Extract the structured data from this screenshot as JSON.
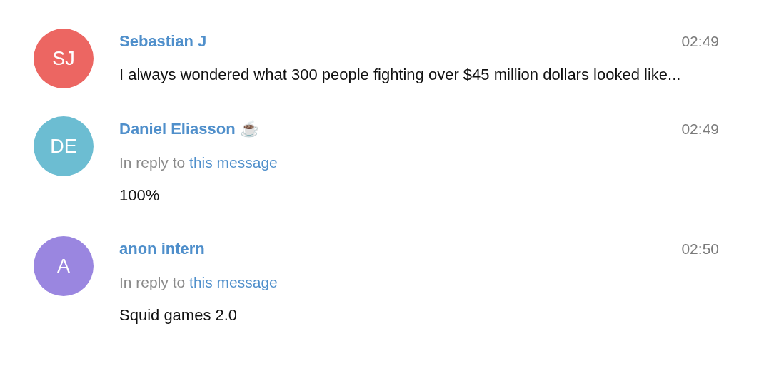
{
  "messages": [
    {
      "author": "Sebastian J",
      "initials": "SJ",
      "color": "#ec6662",
      "time": "02:49",
      "text": "I always wondered what 300 people fighting over $45 million dollars looked like..."
    },
    {
      "author": "Daniel Eliasson ☕",
      "initials": "DE",
      "color": "#6cbdd2",
      "time": "02:49",
      "reply": {
        "prefix": "In reply to",
        "link": "this message"
      },
      "text": "100%"
    },
    {
      "author": "anon intern",
      "initials": "A",
      "color": "#9a86e0",
      "time": "02:50",
      "reply": {
        "prefix": "In reply to",
        "link": "this message"
      },
      "text": "Squid games 2.0"
    }
  ]
}
